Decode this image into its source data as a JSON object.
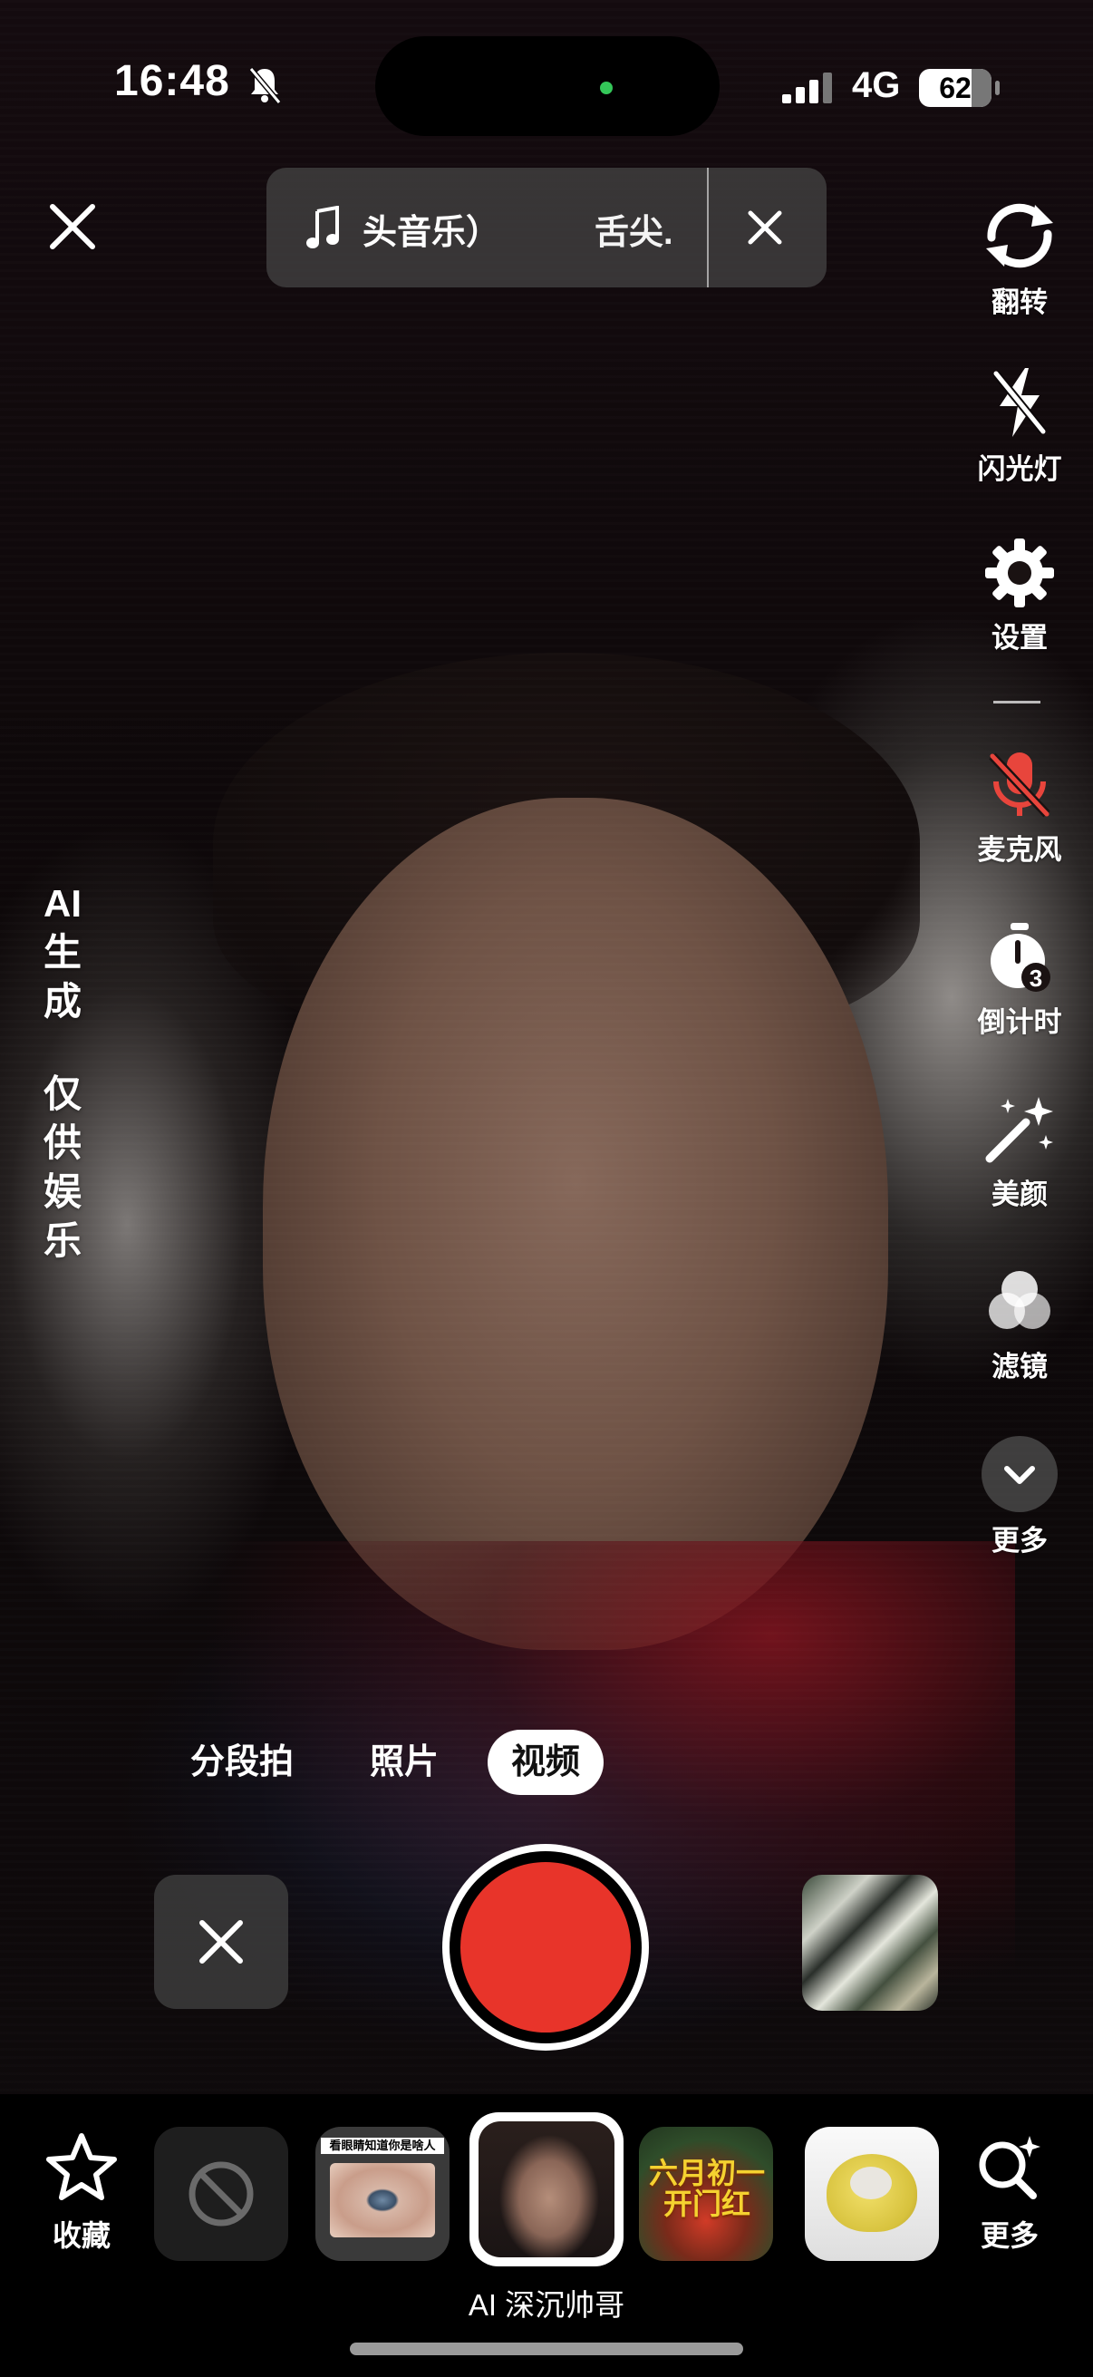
{
  "status_bar": {
    "time": "16:48",
    "network": "4G",
    "battery": "62"
  },
  "music": {
    "title": "头音乐）",
    "title_cont": "舌尖."
  },
  "right_rail": [
    {
      "label": "翻转",
      "icon": "flip-camera-icon"
    },
    {
      "label": "闪光灯",
      "icon": "flash-off-icon"
    },
    {
      "label": "设置",
      "icon": "gear-icon"
    },
    {
      "label": "麦克风",
      "icon": "microphone-muted-icon"
    },
    {
      "label": "倒计时",
      "icon": "timer-icon"
    },
    {
      "label": "美颜",
      "icon": "beauty-wand-icon"
    },
    {
      "label": "滤镜",
      "icon": "filter-icon"
    },
    {
      "label": "更多",
      "icon": "chevron-down-icon"
    }
  ],
  "timer_value": "3",
  "ai_notice": {
    "line1": [
      "AI",
      "生",
      "成"
    ],
    "line2": [
      "仅",
      "供",
      "娱",
      "乐"
    ]
  },
  "modes": {
    "segmented": "分段拍",
    "photo": "照片",
    "video": "视频",
    "active": "视频"
  },
  "effects": {
    "favorite_label": "收藏",
    "more_label": "更多",
    "eyes_caption": "看眼睛知道你是啥人",
    "mayday_text": [
      "六月初一",
      "开门红"
    ],
    "selected_name": "AI 深沉帅哥"
  },
  "colors": {
    "record": "#e8342a",
    "mic_muted": "#e8453c",
    "dynamic_island_dot": "#34c759"
  }
}
